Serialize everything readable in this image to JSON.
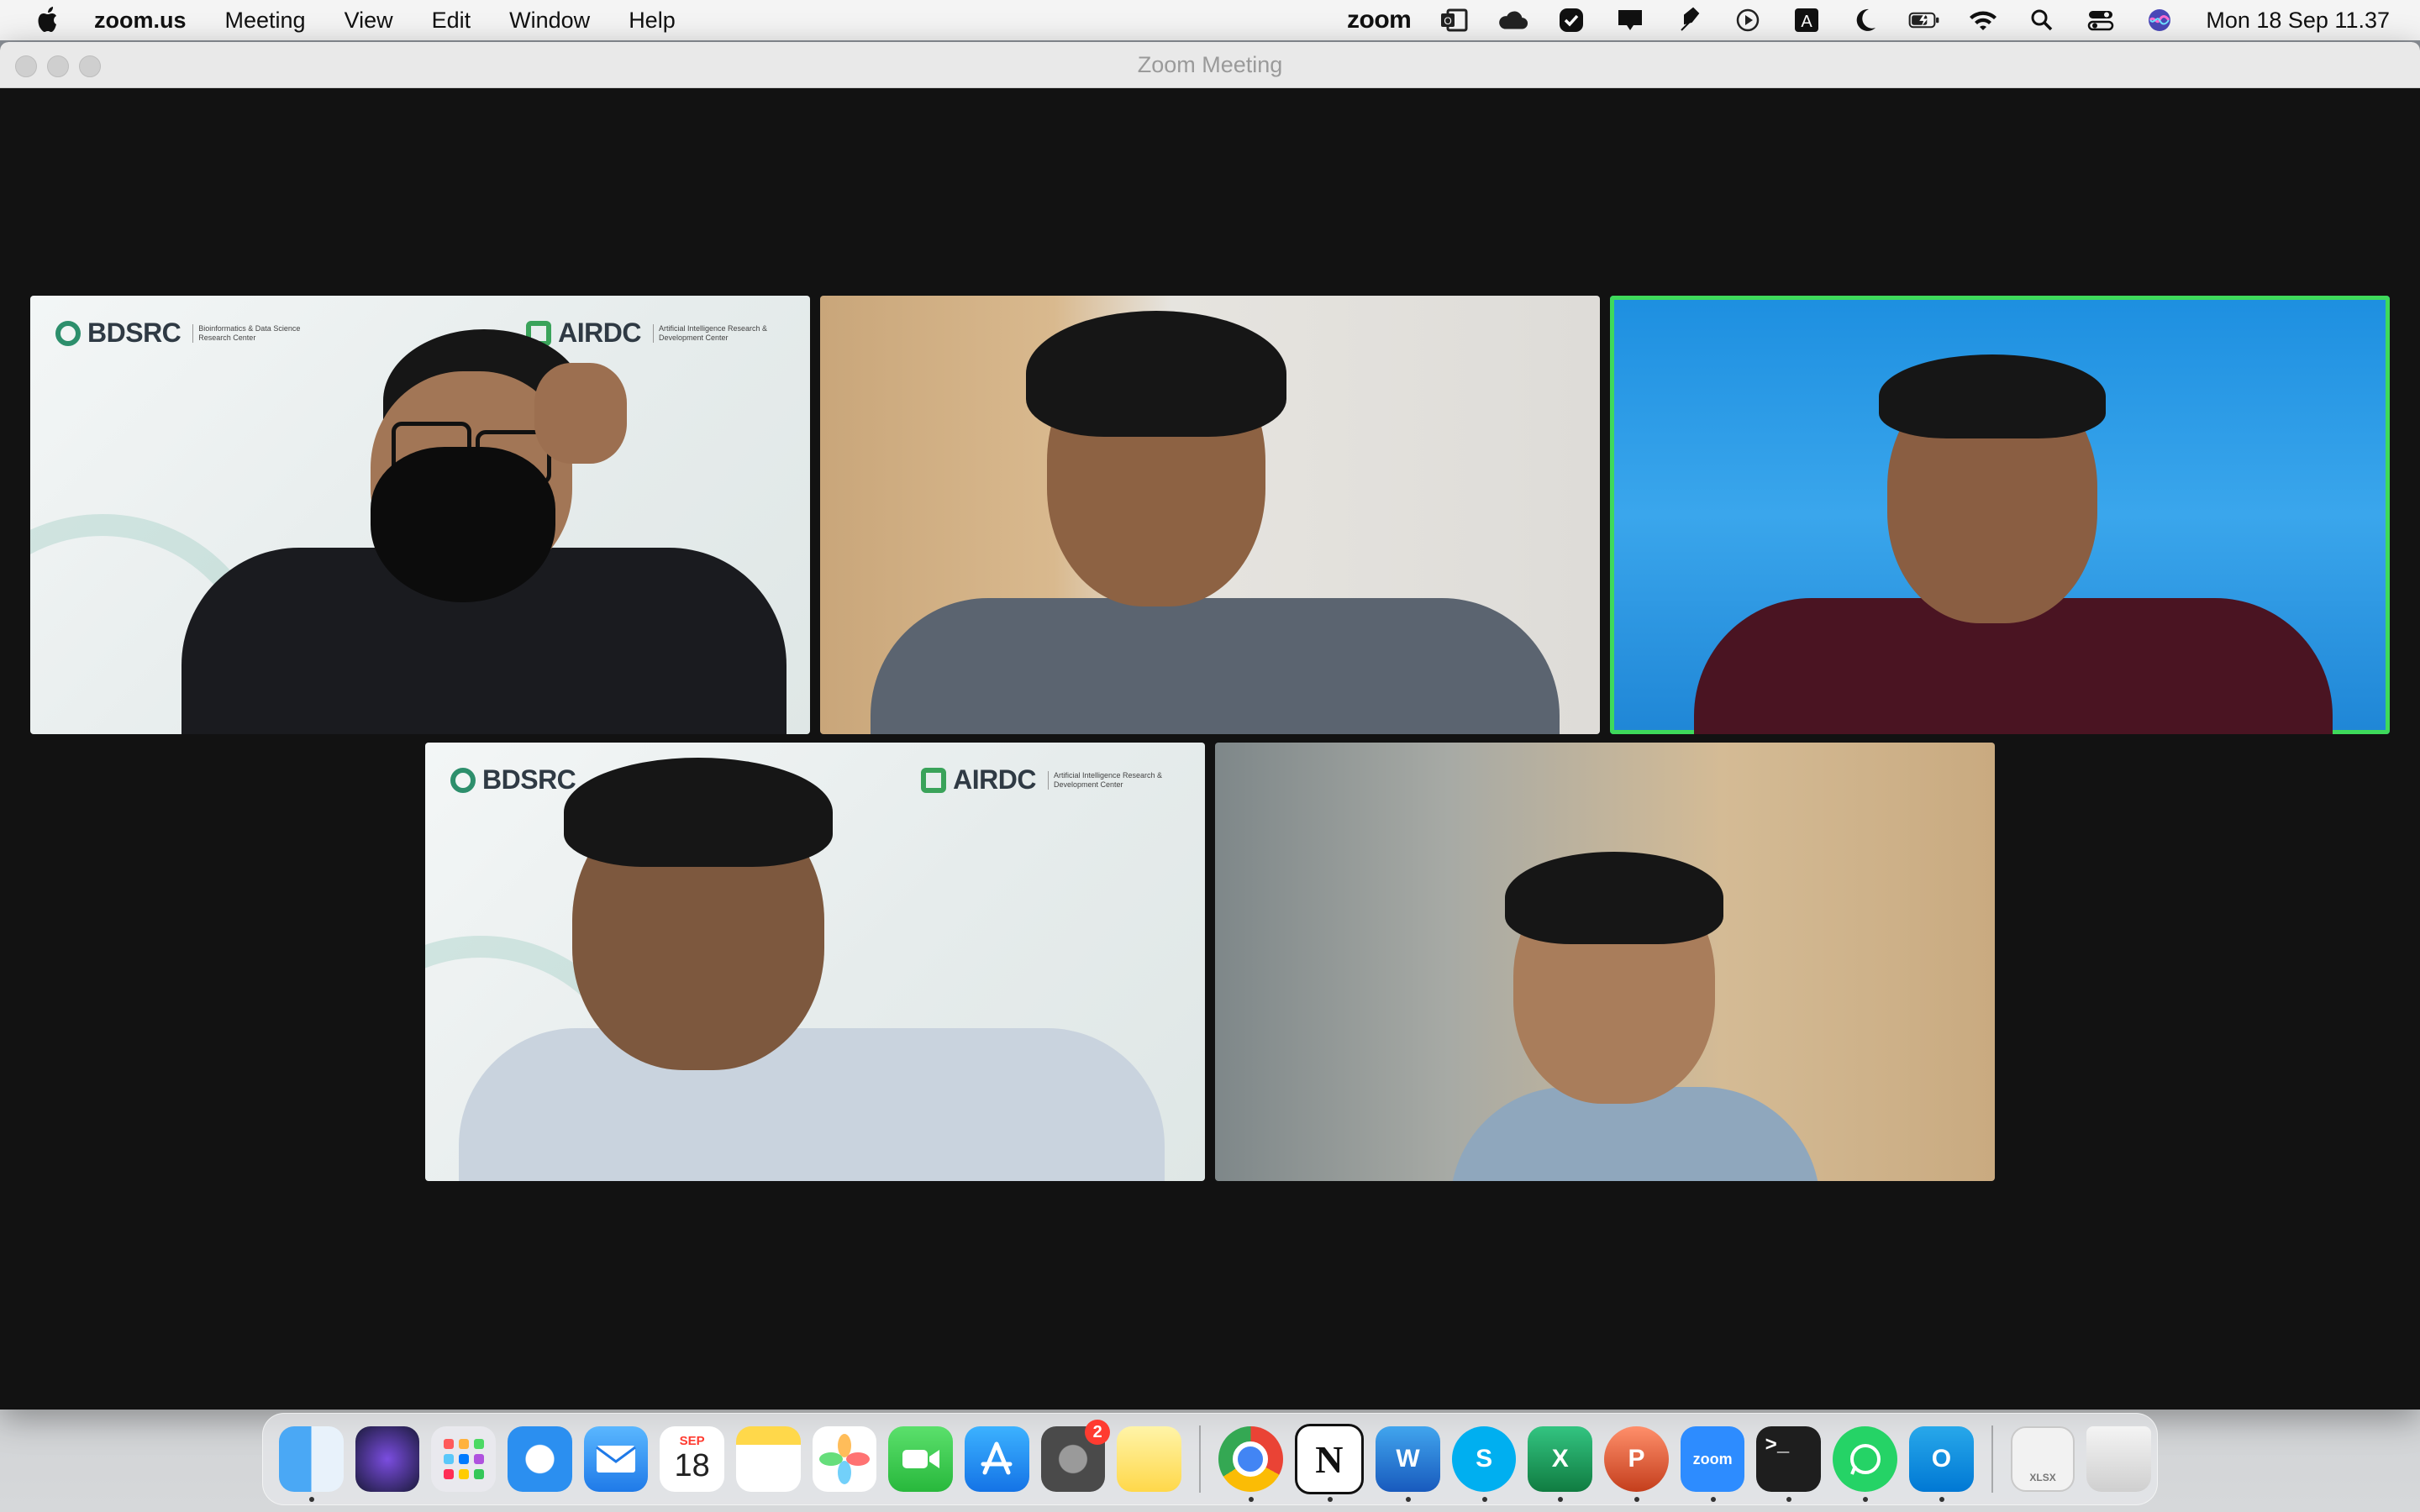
{
  "menubar": {
    "app_name": "zoom.us",
    "menus": [
      "Meeting",
      "View",
      "Edit",
      "Window",
      "Help"
    ],
    "status_zoom": "zoom",
    "clock": "Mon 18 Sep  11.37"
  },
  "window": {
    "title": "Zoom Meeting"
  },
  "tiles": {
    "t1": {
      "logo_left": "BDSRC",
      "logo_left_sub": "Bioinformatics & Data Science Research Center",
      "logo_right": "AIRDC",
      "logo_right_sub": "Artificial Intelligence Research & Development Center"
    },
    "t4": {
      "logo_left": "BDSRC",
      "logo_right": "AIRDC",
      "logo_right_sub": "Artificial Intelligence Research & Development Center"
    }
  },
  "dock": {
    "calendar_month": "SEP",
    "calendar_day": "18",
    "settings_badge": "2",
    "zoom_label": "zoom",
    "xlsx_label": "XLSX"
  },
  "colors": {
    "active_speaker": "#3ed95b",
    "stage_bg": "#121212"
  }
}
